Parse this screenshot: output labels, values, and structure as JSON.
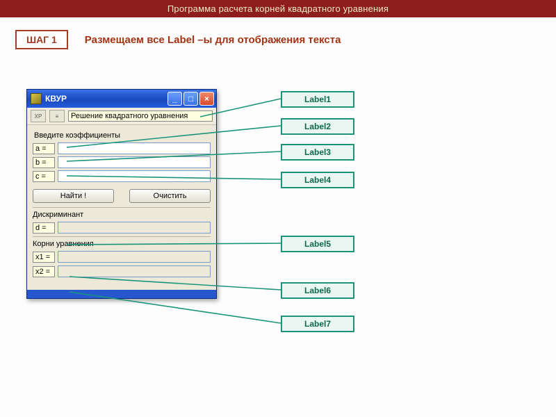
{
  "header": {
    "title": "Программа расчета корней квадратного уравнения"
  },
  "step": {
    "badge": "ШАГ 1",
    "text": "Размещаем все Label –ы для отображения текста"
  },
  "window": {
    "title": "КВУР",
    "toolbar_caption": "Решение квадратного уравнения",
    "section_coeffs": "Введите коэффициенты",
    "a": "a =",
    "b": "b =",
    "c": "c =",
    "btn_find": "Найти !",
    "btn_clear": "Очистить",
    "section_disc": "Дискриминант",
    "d": "d =",
    "section_roots": "Корни уравнения",
    "x1": "x1 =",
    "x2": "x2 ="
  },
  "callouts": {
    "l1": "Label1",
    "l2": "Label2",
    "l3": "Label3",
    "l4": "Label4",
    "l5": "Label5",
    "l6": "Label6",
    "l7": "Label7"
  }
}
